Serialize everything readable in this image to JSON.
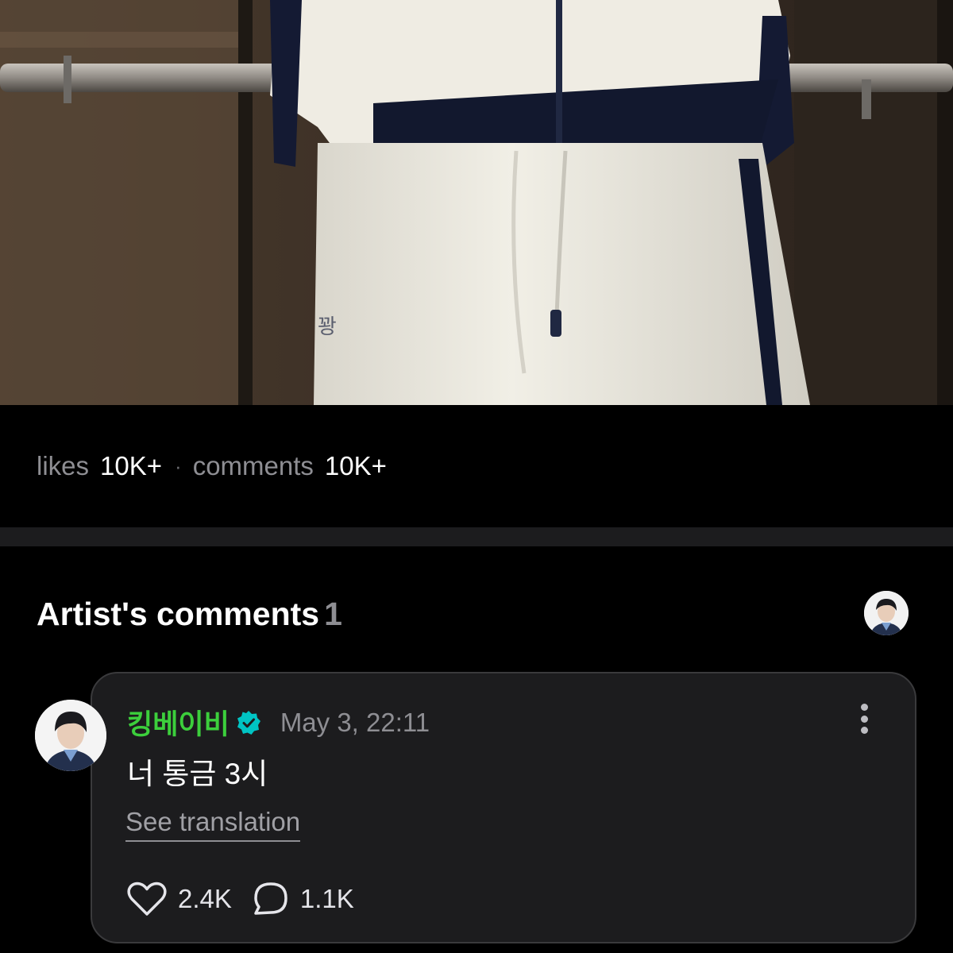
{
  "post": {
    "photo": {
      "subject": "person in cream track jacket with navy trim and matching track pants in an elevator"
    },
    "stats": {
      "likes_label": "likes",
      "likes_value": "10K+",
      "separator": "·",
      "comments_label": "comments",
      "comments_value": "10K+"
    }
  },
  "artist_comments": {
    "title": "Artist's comments",
    "count": "1",
    "items": [
      {
        "author": "킹베이비",
        "verified": true,
        "timestamp": "May 3, 22:11",
        "text": "너 통금 3시",
        "translate_label": "See translation",
        "likes": "2.4K",
        "replies": "1.1K"
      }
    ]
  },
  "colors": {
    "background": "#000000",
    "card": "#1c1c1e",
    "author_name": "#3ccf3c",
    "verified_badge": "#00c4c4",
    "muted_text": "#8e8e93"
  },
  "icons": [
    "heart-icon",
    "comment-bubble-icon",
    "more-vertical-icon",
    "verified-badge-icon"
  ]
}
